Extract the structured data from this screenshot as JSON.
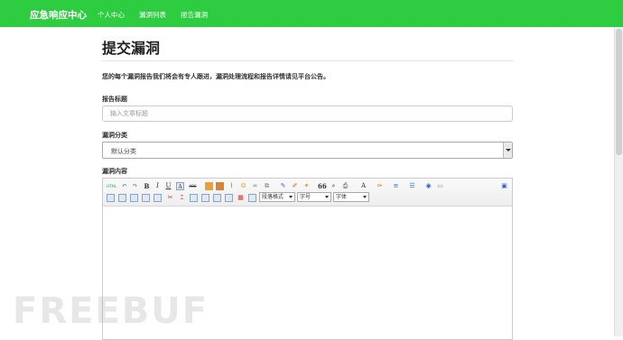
{
  "navbar": {
    "brand": "应急响应中心",
    "links": [
      "个人中心",
      "漏洞列表",
      "报告漏洞"
    ],
    "bg_color": "#2ecc40"
  },
  "main": {
    "title": "提交漏洞",
    "notice": "您的每个漏洞报告我们将会有专人跟进，漏洞处理流程和报告详情请见平台公告。",
    "report_title_label": "报告标题",
    "report_title_placeholder": "输入文章标题",
    "category_label": "漏洞分类",
    "category_value": "默认分类",
    "content_label": "漏洞内容"
  },
  "editor": {
    "row1_text_buttons": [
      "HTML",
      "B",
      "I",
      "U",
      "A",
      "ABC",
      "66",
      "A"
    ],
    "paragraph_format": "段落格式",
    "font_size": "字号",
    "font_family": "字体"
  },
  "watermark": "FREEBUF"
}
